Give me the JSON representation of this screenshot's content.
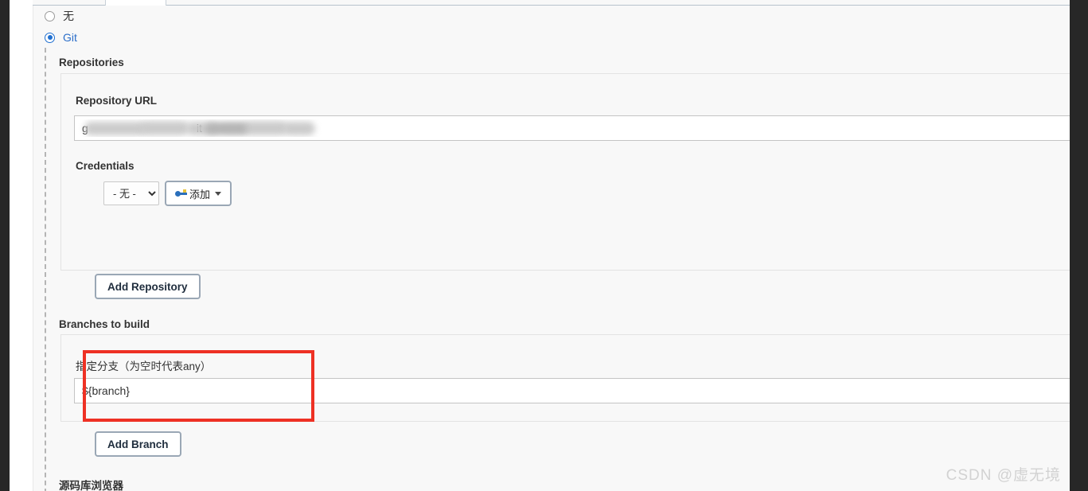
{
  "window": {
    "watermark": "CSDN @虚无境"
  },
  "scm": {
    "options": [
      {
        "label": "无",
        "selected": false
      },
      {
        "label": "Git",
        "selected": true
      }
    ],
    "repositories_heading": "Repositories",
    "repository": {
      "url_label": "Repository URL",
      "url_value": "g                                   it",
      "url_redacted": true,
      "credentials_label": "Credentials",
      "credentials_selected": "- 无 -",
      "add_credentials_label": "添加",
      "add_credentials_icon": "key-icon",
      "dropdown_icon": "chevron-down-icon"
    },
    "add_repository_label": "Add Repository",
    "branches_heading": "Branches to build",
    "branch": {
      "label": "指定分支（为空时代表any）",
      "value": "${branch}"
    },
    "add_branch_label": "Add Branch",
    "browser_heading": "源码库浏览器",
    "highlight_color": "#ee3124"
  }
}
